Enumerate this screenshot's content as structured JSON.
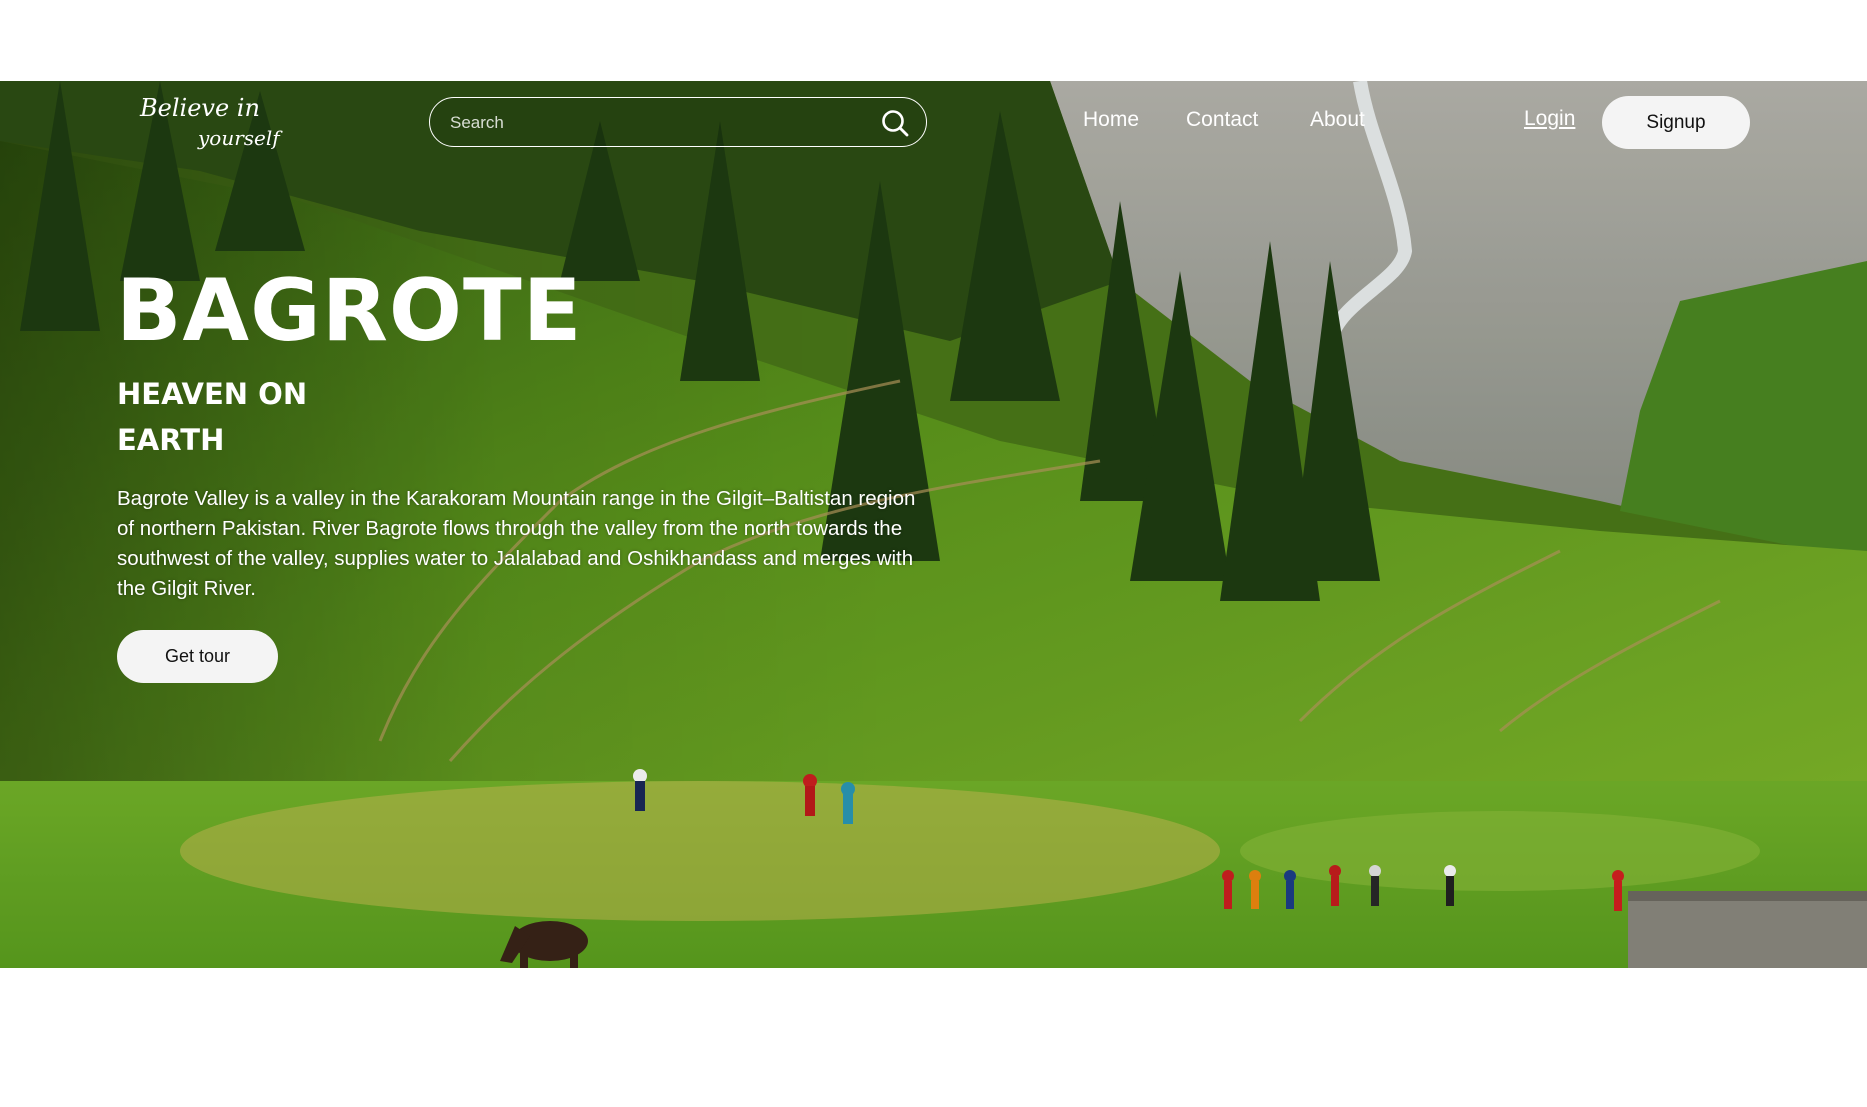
{
  "header": {
    "logo_line1": "Believe in",
    "logo_line2": "yourself",
    "search_placeholder": "Search",
    "nav": [
      "Home",
      "Contact",
      "About"
    ],
    "login_label": "Login",
    "signup_label": "Signup"
  },
  "hero": {
    "title": "BAGROTE",
    "subtitle": "HEAVEN ON EARTH",
    "description": "Bagrote Valley is a valley in the Karakoram Mountain range in the Gilgit–Baltistan region of northern Pakistan. River Bagrote flows through the valley from the north towards the southwest of the valley, supplies water to Jalalabad and Oshikhandass and merges with the Gilgit River.",
    "cta_label": "Get tour"
  },
  "colors": {
    "text": "#ffffff",
    "button_bg": "#f4f4f4",
    "button_text": "#111111",
    "page_bg": "#ffffff"
  },
  "icons": [
    "search-icon"
  ]
}
